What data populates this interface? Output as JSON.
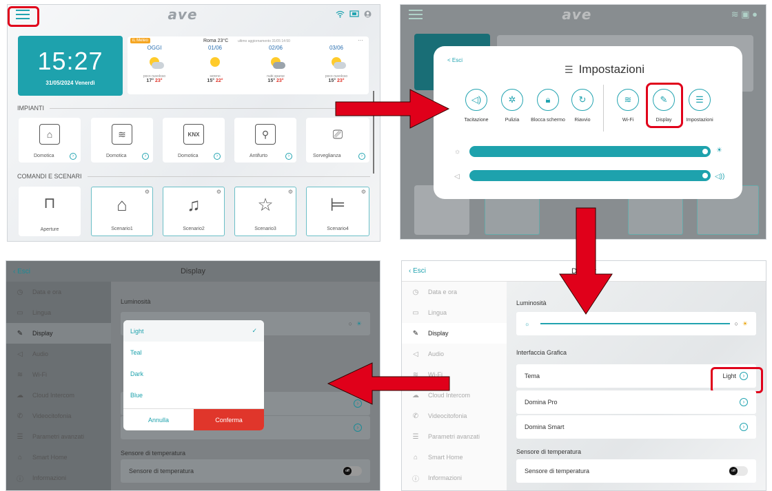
{
  "colors": {
    "accent": "#1ea2ad",
    "highlight": "#e0001a"
  },
  "home": {
    "logo": "ave",
    "time": "15:27",
    "date": "31/05/2024 Venerdì",
    "weather": {
      "tag": "iL Meteo",
      "header": "Roma 23°C",
      "updated": "ultimo aggiornamento 31/05 14:50",
      "days": [
        {
          "label": "OGGI",
          "desc": "poco nuvoloso",
          "min": "17°",
          "max": "23°"
        },
        {
          "label": "01/06",
          "desc": "sereno",
          "min": "15°",
          "max": "22°"
        },
        {
          "label": "02/06",
          "desc": "nubi sparse",
          "min": "15°",
          "max": "23°"
        },
        {
          "label": "03/06",
          "desc": "poco nuvoloso",
          "min": "15°",
          "max": "23°"
        }
      ]
    },
    "section1": "IMPIANTI",
    "section2": "COMANDI E SCENARI",
    "plants": [
      {
        "label": "Domotica",
        "icon": "house-icon"
      },
      {
        "label": "Domotica",
        "icon": "wifi-house-icon"
      },
      {
        "label": "Domotica",
        "icon": "knx-icon"
      },
      {
        "label": "Antifurto",
        "icon": "alarm-icon"
      },
      {
        "label": "Sorveglianza",
        "icon": "camera-icon"
      }
    ],
    "knx": "KNX",
    "scenes": [
      {
        "label": "Aperture"
      },
      {
        "label": "Scenario1"
      },
      {
        "label": "Scenario2"
      },
      {
        "label": "Scenario3"
      },
      {
        "label": "Scenario4"
      }
    ]
  },
  "settings_dialog": {
    "back": "< Esci",
    "title": "Impostazioni",
    "items": [
      "Tacitazione",
      "Pulizia",
      "Blocca schermo",
      "Riavvio",
      "Wi-Fi",
      "Display",
      "Impostazioni"
    ],
    "brightness": 0.98,
    "volume": 0.98
  },
  "display": {
    "back": "Esci",
    "title": "Display",
    "sidebar": [
      "Data e ora",
      "Lingua",
      "Display",
      "Audio",
      "Wi-Fi",
      "Cloud Intercom",
      "Videocitofonia",
      "Parametri avanzati",
      "Smart Home",
      "Informazioni"
    ],
    "luminosita": "Luminosità",
    "interfaccia": "Interfaccia Grafica",
    "tema": "Tema",
    "tema_value": "Light",
    "domina_pro": "Domina Pro",
    "domina_smart": "Domina Smart",
    "sensore_title": "Sensore di temperatura",
    "sensore": "Sensore di temperatura",
    "toggle": "off"
  },
  "theme_popup": {
    "options": [
      "Light",
      "Teal",
      "Dark",
      "Blue"
    ],
    "selected": "Light",
    "cancel": "Annulla",
    "confirm": "Conferma"
  }
}
